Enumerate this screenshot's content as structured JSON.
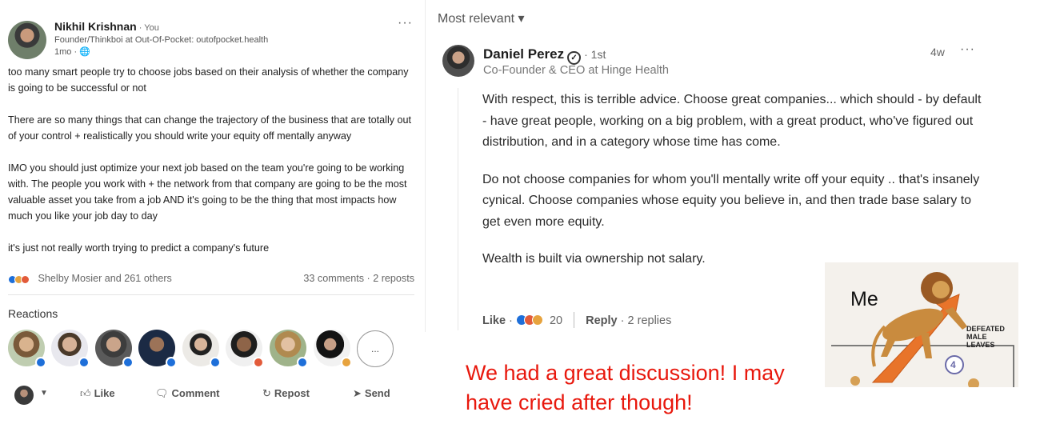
{
  "post": {
    "author": "Nikhil Krishnan",
    "you_tag": " · You",
    "headline": "Founder/Thinkboi at Out-Of-Pocket: outofpocket.health",
    "meta": "1mo · 🌐",
    "more": "···",
    "body": [
      "too many smart people try to choose jobs based on their analysis of whether the company is going to be successful or not",
      "There are so many things that can change the trajectory of the business that are totally out of your control + realistically you should write your equity off mentally anyway",
      "IMO you should just optimize your next job based on the team you're going to be working with. The people you work with + the network from that company are going to be the most valuable asset you take from a job AND it's going to be the thing that most impacts how much you like your job day to day",
      "it's just not really worth trying to predict a company's future"
    ],
    "social_names": "Shelby Mosier and 261 others",
    "social_counts": "33 comments · 2 reposts",
    "reactions_title": "Reactions",
    "faces_more": "...",
    "actions": {
      "like": "Like",
      "comment": "Comment",
      "repost": "Repost",
      "send": "Send"
    }
  },
  "comments": {
    "sort_label": "Most relevant ▾",
    "author": "Daniel Perez",
    "verified_mark": "✓",
    "degree": "· 1st",
    "headline": "Co-Founder & CEO at Hinge Health",
    "time": "4w",
    "more": "···",
    "body": [
      "With respect, this is terrible advice. Choose great companies... which should - by default - have great people, working on a big problem, with a great product, who've figured out distribution, and in a category whose time has come.",
      "Do not choose companies for whom you'll mentally write off your equity .. that's insanely cynical. Choose companies whose equity you believe in, and then trade base salary to get even more equity.",
      "Wealth is built via ownership not salary."
    ],
    "like_label": "Like",
    "reaction_count": "20",
    "reply_label": "Reply",
    "replies": "2 replies"
  },
  "caption": "We had a great discussion! I may have cried after though!",
  "meme": {
    "me_label": "Me",
    "sign_text": "DEFEATED MALE LEAVES",
    "step_number": "4"
  },
  "colors": {
    "caption_red": "#e8180d",
    "like_blue": "#1e6fd9",
    "celebrate_green": "#5a9a3a",
    "love_red": "#e25b3a",
    "insight_yellow": "#e7a33e",
    "arrow_orange": "#e8742a"
  }
}
